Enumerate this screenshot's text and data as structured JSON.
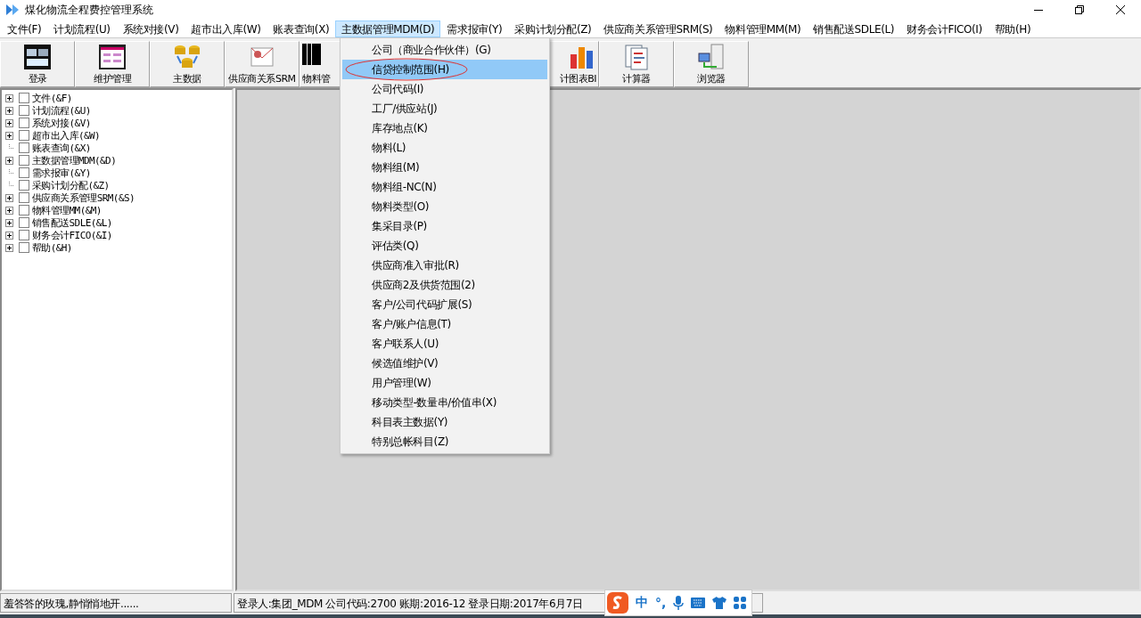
{
  "window": {
    "title": "煤化物流全程费控管理系统"
  },
  "menubar": [
    {
      "label": "文件(F)",
      "selected": false
    },
    {
      "label": "计划流程(U)",
      "selected": false
    },
    {
      "label": "系统对接(V)",
      "selected": false
    },
    {
      "label": "超市出入库(W)",
      "selected": false
    },
    {
      "label": "账表查询(X)",
      "selected": false
    },
    {
      "label": "主数据管理MDM(D)",
      "selected": true
    },
    {
      "label": "需求报审(Y)",
      "selected": false
    },
    {
      "label": "采购计划分配(Z)",
      "selected": false
    },
    {
      "label": "供应商关系管理SRM(S)",
      "selected": false
    },
    {
      "label": "物料管理MM(M)",
      "selected": false
    },
    {
      "label": "销售配送SDLE(L)",
      "selected": false
    },
    {
      "label": "财务会计FICO(I)",
      "selected": false
    },
    {
      "label": "帮助(H)",
      "selected": false
    }
  ],
  "toolbar": [
    {
      "label": "登录",
      "kind": "login"
    },
    {
      "label": "维护管理",
      "kind": "form"
    },
    {
      "label": "主数据",
      "kind": "database"
    },
    {
      "label": "供应商关系SRM",
      "kind": "mail"
    },
    {
      "label": "物料管",
      "kind": "barcode"
    },
    {
      "kind": "hidden"
    },
    {
      "kind": "hidden"
    },
    {
      "label": "计图表BI",
      "kind": "chart"
    },
    {
      "label": "计算器",
      "kind": "document"
    },
    {
      "label": "浏览器",
      "kind": "server"
    }
  ],
  "tree": [
    {
      "label": "文件(&F)",
      "expandable": true,
      "checked": false
    },
    {
      "label": "计划流程(&U)",
      "expandable": true,
      "checked": false
    },
    {
      "label": "系统对接(&V)",
      "expandable": true,
      "checked": false
    },
    {
      "label": "超市出入库(&W)",
      "expandable": true,
      "checked": false
    },
    {
      "label": "账表查询(&X)",
      "expandable": false,
      "checked": false
    },
    {
      "label": "主数据管理MDM(&D)",
      "expandable": true,
      "checked": false
    },
    {
      "label": "需求报审(&Y)",
      "expandable": false,
      "checked": false
    },
    {
      "label": "采购计划分配(&Z)",
      "expandable": false,
      "checked": false
    },
    {
      "label": "供应商关系管理SRM(&S)",
      "expandable": true,
      "checked": false
    },
    {
      "label": "物料管理MM(&M)",
      "expandable": true,
      "checked": false
    },
    {
      "label": "销售配送SDLE(&L)",
      "expandable": true,
      "checked": false
    },
    {
      "label": "财务会计FICO(&I)",
      "expandable": true,
      "checked": false
    },
    {
      "label": "帮助(&H)",
      "expandable": true,
      "checked": false
    }
  ],
  "dropdown": [
    {
      "label": "公司（商业合作伙伴）(G)",
      "selected": false,
      "circled": false
    },
    {
      "label": "信贷控制范围(H)",
      "selected": true,
      "circled": true
    },
    {
      "label": "公司代码(I)",
      "selected": false,
      "circled": false
    },
    {
      "label": "工厂/供应站(J)",
      "selected": false,
      "circled": false
    },
    {
      "label": "库存地点(K)",
      "selected": false,
      "circled": false
    },
    {
      "label": "物料(L)",
      "selected": false,
      "circled": false
    },
    {
      "label": "物料组(M)",
      "selected": false,
      "circled": false
    },
    {
      "label": "物料组-NC(N)",
      "selected": false,
      "circled": false
    },
    {
      "label": "物料类型(O)",
      "selected": false,
      "circled": false
    },
    {
      "label": "集采目录(P)",
      "selected": false,
      "circled": false
    },
    {
      "label": "评估类(Q)",
      "selected": false,
      "circled": false
    },
    {
      "label": "供应商准入审批(R)",
      "selected": false,
      "circled": false
    },
    {
      "label": "供应商2及供货范围(2)",
      "selected": false,
      "circled": false
    },
    {
      "label": "客户/公司代码扩展(S)",
      "selected": false,
      "circled": false
    },
    {
      "label": "客户/账户信息(T)",
      "selected": false,
      "circled": false
    },
    {
      "label": "客户联系人(U)",
      "selected": false,
      "circled": false
    },
    {
      "label": "候选值维护(V)",
      "selected": false,
      "circled": false
    },
    {
      "label": "用户管理(W)",
      "selected": false,
      "circled": false
    },
    {
      "label": "移动类型-数量串/价值串(X)",
      "selected": false,
      "circled": false
    },
    {
      "label": "科目表主数据(Y)",
      "selected": false,
      "circled": false
    },
    {
      "label": "特别总帐科目(Z)",
      "selected": false,
      "circled": false
    }
  ],
  "status_bar": {
    "message": "羞答答的玫瑰,静悄悄地开......",
    "login_info": "登录人:集团_MDM 公司代码:2700 账期:2016-12 登录日期:2017年6月7日"
  },
  "ime_bar": {
    "mode": "中",
    "punctuation": "°,"
  }
}
